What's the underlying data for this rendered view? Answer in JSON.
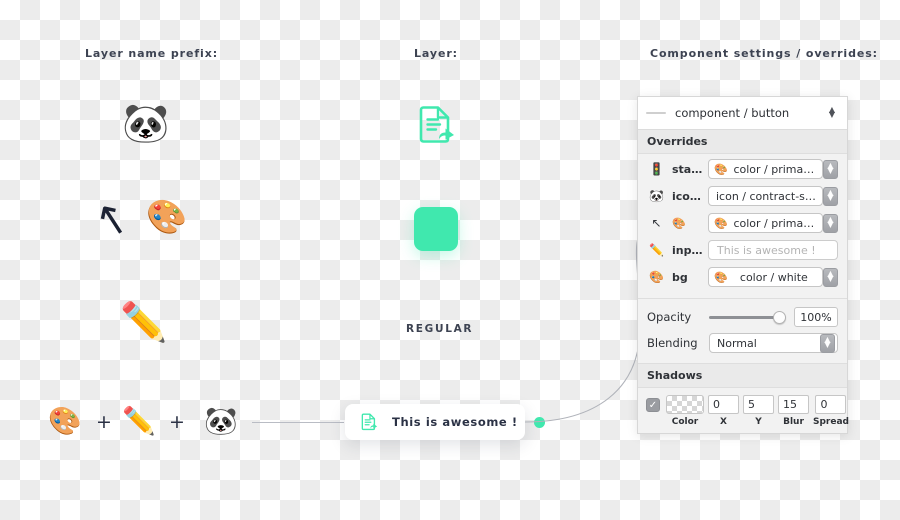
{
  "headings": {
    "left": "Layer name prefix:",
    "center": "Layer:",
    "right": "Component settings / overrides:"
  },
  "left_column": {
    "prefix_glyphs": [
      {
        "name": "panda-face-emoji",
        "glyph": "🐼"
      },
      {
        "name": "cursor-arrow-icon",
        "glyph": "↖"
      },
      {
        "name": "artist-palette-emoji",
        "glyph": "🎨"
      },
      {
        "name": "pencil-emoji",
        "glyph": "✏️"
      }
    ],
    "formula": {
      "items": [
        "🎨",
        "✏️",
        "🐼"
      ],
      "operator": "+"
    }
  },
  "center_column": {
    "contract_sent_icon": "contract-sent-icon",
    "mint_square": "rounded-square-shape",
    "regular_label": "REGULAR",
    "button": {
      "icon": "contract-sent-icon",
      "label": "This is awesome !",
      "dot": "status-dot",
      "dot_color": "#40e8ae"
    }
  },
  "panel": {
    "header": {
      "icon": "dash-icon",
      "title": "component / button",
      "stepper": "⌃⌄"
    },
    "overrides_title": "Overrides",
    "overrides": [
      {
        "row_emoji": "🚦",
        "row_emoji_name": "traffic-light-emoji",
        "key": "sta…",
        "field_emoji": "🎨",
        "field_emoji_name": "artist-palette-emoji",
        "value": "color / prima…",
        "has_stepper": true,
        "placeholder": false
      },
      {
        "row_emoji": "🐼",
        "row_emoji_name": "panda-face-emoji",
        "key": "ico…",
        "field_emoji": "",
        "field_emoji_name": "none-icon",
        "value": "icon / contract-sent",
        "has_stepper": true,
        "placeholder": false
      },
      {
        "row_emoji": "↖",
        "row_emoji_name": "cursor-arrow-icon",
        "key": "🎨",
        "field_emoji": "🎨",
        "field_emoji_name": "artist-palette-emoji",
        "value": "color / prima…",
        "has_stepper": true,
        "placeholder": false
      },
      {
        "row_emoji": "✏️",
        "row_emoji_name": "pencil-emoji",
        "key": "inp…",
        "field_emoji": "",
        "field_emoji_name": "none-icon",
        "value": "This is awesome !",
        "has_stepper": false,
        "placeholder": true
      },
      {
        "row_emoji": "🎨",
        "row_emoji_name": "artist-palette-emoji",
        "key": "bg",
        "field_emoji": "🎨",
        "field_emoji_name": "artist-palette-emoji",
        "value": "color / white",
        "has_stepper": true,
        "placeholder": false
      }
    ],
    "opacity": {
      "label": "Opacity",
      "value": "100%",
      "slider_percent": 100
    },
    "blending": {
      "label": "Blending",
      "value": "Normal"
    },
    "shadows_title": "Shadows",
    "shadow": {
      "enabled": true,
      "check_glyph": "✓",
      "color_caption": "Color",
      "fields": [
        {
          "caption": "X",
          "value": "0"
        },
        {
          "caption": "Y",
          "value": "5"
        },
        {
          "caption": "Blur",
          "value": "15"
        },
        {
          "caption": "Spread",
          "value": "0"
        }
      ]
    }
  },
  "colors": {
    "mint": "#40e8ae",
    "panel_bg": "#f2f2f2",
    "heading_text": "#3d4352"
  }
}
